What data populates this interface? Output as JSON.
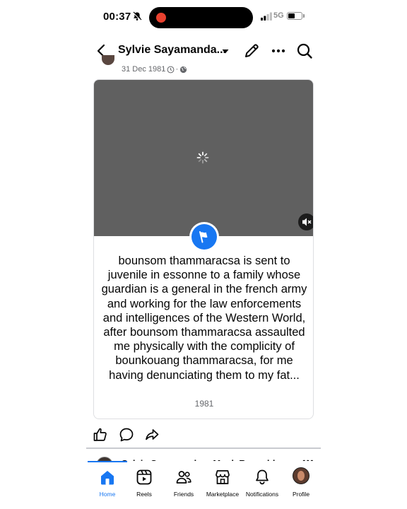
{
  "status_bar": {
    "time": "00:37",
    "network": "5G",
    "battery_level": 0.55
  },
  "header": {
    "title": "Sylvie Sayamanda...",
    "icons": [
      "back-arrow-icon",
      "chevron-down-icon",
      "pencil-icon",
      "more-icon",
      "search-icon"
    ]
  },
  "post": {
    "date": "31 Dec 1981",
    "separator": "·",
    "text": "bounsom thammaracsa is sent to juvenile in essonne to a family whose guardian is a general in the french army and working for the law enforcements and intelligences of the Western World, after bounsom thammaracsa assaulted me physically with the complicity of bounkouang thammaracsa, for me having denunciating them to my fat...",
    "year": "1981",
    "colors": {
      "video_bg": "#606060",
      "flag_badge": "#1877f2"
    }
  },
  "reactions": {
    "icons": [
      "like-icon",
      "comment-icon",
      "share-icon"
    ]
  },
  "next_post": {
    "author": "Sylvie Sayamandara Musk Reynolds",
    "more": "•••"
  },
  "nav": {
    "accent": "#1877f2",
    "items": [
      {
        "label": "Home"
      },
      {
        "label": "Reels"
      },
      {
        "label": "Friends"
      },
      {
        "label": "Marketplace"
      },
      {
        "label": "Notifications"
      },
      {
        "label": "Profile"
      }
    ]
  }
}
